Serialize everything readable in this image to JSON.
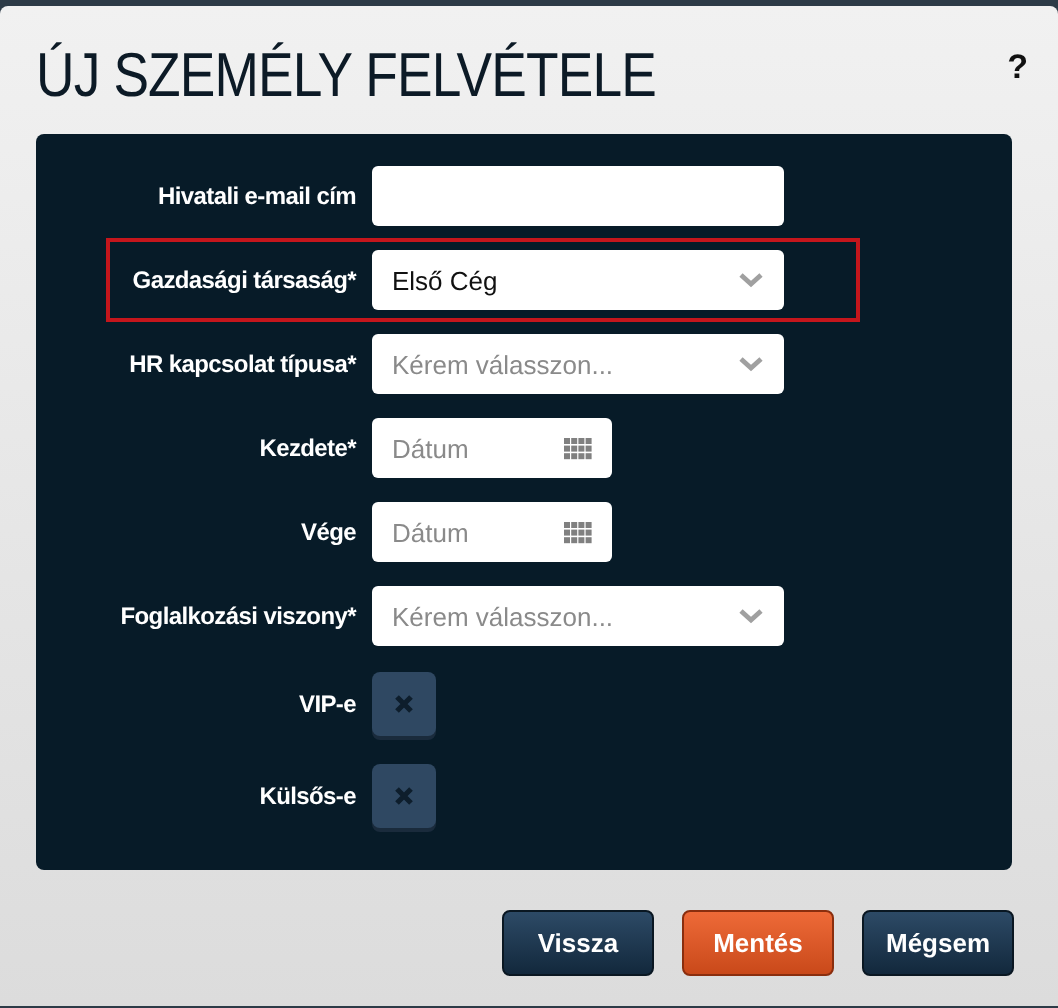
{
  "title": "ÚJ SZEMÉLY FELVÉTELE",
  "help": "?",
  "fields": [
    {
      "kind": "text",
      "label": "Hivatali e-mail cím",
      "highlighted": false
    },
    {
      "kind": "select",
      "label": "Gazdasági társaság*",
      "value": "Első Cég",
      "highlighted": true
    },
    {
      "kind": "select",
      "label": "HR kapcsolat típusa*",
      "placeholder": "Kérem válasszon...",
      "highlighted": false
    },
    {
      "kind": "date",
      "label": "Kezdete*",
      "placeholder": "Dátum",
      "highlighted": false
    },
    {
      "kind": "date",
      "label": "Vége",
      "placeholder": "Dátum",
      "highlighted": false
    },
    {
      "kind": "select",
      "label": "Foglalkozási viszony*",
      "placeholder": "Kérem válasszon...",
      "highlighted": false
    },
    {
      "kind": "checkbox",
      "label": "VIP-e",
      "checked": false,
      "highlighted": false
    },
    {
      "kind": "checkbox",
      "label": "Külsős-e",
      "checked": false,
      "highlighted": false
    }
  ],
  "buttons": [
    {
      "label": "Vissza",
      "kind": "secondary"
    },
    {
      "label": "Mentés",
      "kind": "primary"
    },
    {
      "label": "Mégsem",
      "kind": "secondary"
    }
  ]
}
